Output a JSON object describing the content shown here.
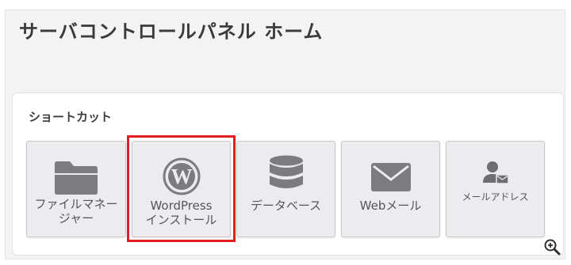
{
  "header": {
    "title": "サーバコントロールパネル ホーム"
  },
  "shortcuts": {
    "title": "ショートカット",
    "items": [
      {
        "line1": "ファイルマネー",
        "line2": "ジャー",
        "icon": "folder-icon"
      },
      {
        "line1": "WordPress",
        "line2": "インストール",
        "icon": "wordpress-icon",
        "selected": true
      },
      {
        "label": "データベース",
        "icon": "database-icon"
      },
      {
        "label": "Webメール",
        "icon": "mail-icon"
      },
      {
        "label": "メールアドレス",
        "icon": "mail-user-icon"
      }
    ]
  },
  "colors": {
    "highlight": "#e21e1e",
    "icon_gray": "#7c7c80",
    "tile_background": "#ececef"
  },
  "zoom": {
    "icon": "zoom-in-icon"
  }
}
